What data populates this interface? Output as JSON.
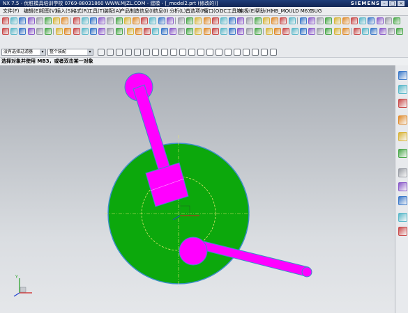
{
  "title_bar": {
    "title": "NX 7.5 - 优胜模具培训学校  0769-88031860  WWW.MJZL.COM - 建模 - [_model2.prt (修改的)]",
    "brand": "SIEMENS"
  },
  "menu": [
    "文件(F)",
    "编辑(E)",
    "视图(V)",
    "插入(S)",
    "格式(R)",
    "工具(T)",
    "装配(A)",
    "产品制造信息(I)",
    "信息(I)",
    "分析(L)",
    "首选项(P)",
    "窗口(O)",
    "GC工具箱",
    "电极(E)",
    "帮助(H)",
    "HB_MOULD M6.0",
    "YSUG"
  ],
  "filter_bar": {
    "type_filter": "没有选择过滤器",
    "scope": "整个装配"
  },
  "cue_line": "选择对象并使用 MB3，或者双击某一对象",
  "model": {
    "base_disk_color": "#0ca80c",
    "arm_color": "#ff00ff",
    "sketch_color": "#e6e66e"
  },
  "colors": {
    "title_bar": "#1a356f",
    "viewport_top": "#a8adb4",
    "viewport_bottom": "#e5e7ea"
  }
}
